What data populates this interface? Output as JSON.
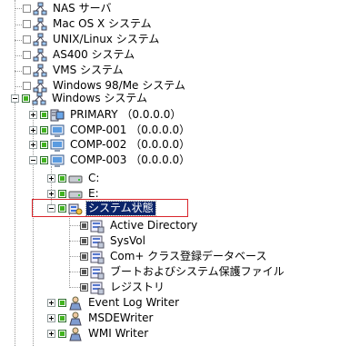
{
  "tree": {
    "items": [
      {
        "label": "NAS サーバ",
        "icon": "network-icon",
        "check": "empty"
      },
      {
        "label": "Mac OS X システム",
        "icon": "network-icon",
        "check": "empty"
      },
      {
        "label": "UNIX/Linux システム",
        "icon": "network-icon",
        "check": "empty"
      },
      {
        "label": "AS400 システム",
        "icon": "network-icon",
        "check": "empty"
      },
      {
        "label": "VMS システム",
        "icon": "network-icon",
        "check": "empty"
      },
      {
        "label": "Windows 98/Me システム",
        "icon": "network-icon",
        "check": "empty"
      },
      {
        "label": "Windows システム",
        "icon": "network-icon",
        "check": "green",
        "expanded": true
      },
      {
        "label": "PRIMARY （0.0.0.0）",
        "icon": "server-icon",
        "check": "green",
        "expanded": false
      },
      {
        "label": "COMP-001 （0.0.0.0）",
        "icon": "monitor-icon",
        "check": "green",
        "expanded": false
      },
      {
        "label": "COMP-002 （0.0.0.0）",
        "icon": "monitor-icon",
        "check": "green",
        "expanded": false
      },
      {
        "label": "COMP-003 （0.0.0.0）",
        "icon": "monitor-icon",
        "check": "green",
        "expanded": true
      },
      {
        "label": "C:",
        "icon": "drive-icon",
        "check": "green",
        "expanded": false
      },
      {
        "label": "E:",
        "icon": "drive-icon",
        "check": "green",
        "expanded": false
      },
      {
        "label": "システム状態",
        "icon": "system-state-icon",
        "check": "green",
        "expanded": true,
        "selected": true
      },
      {
        "label": "Active Directory",
        "icon": "component-icon",
        "check": "gray"
      },
      {
        "label": "SysVol",
        "icon": "component-icon",
        "check": "gray"
      },
      {
        "label": "Com+ クラス登録データベース",
        "icon": "component-icon",
        "check": "gray"
      },
      {
        "label": "ブートおよびシステム保護ファイル",
        "icon": "component-icon",
        "check": "gray"
      },
      {
        "label": "レジストリ",
        "icon": "component-icon",
        "check": "gray"
      },
      {
        "label": "Event Log Writer",
        "icon": "writer-icon",
        "check": "green",
        "expanded": false
      },
      {
        "label": "MSDEWriter",
        "icon": "writer-icon",
        "check": "green",
        "expanded": false
      },
      {
        "label": "WMI Writer",
        "icon": "writer-icon",
        "check": "green",
        "expanded": false
      }
    ]
  },
  "colors": {
    "selection": "#0a246a",
    "highlight_box": "#d9252b",
    "check_green": "#41b31f"
  }
}
